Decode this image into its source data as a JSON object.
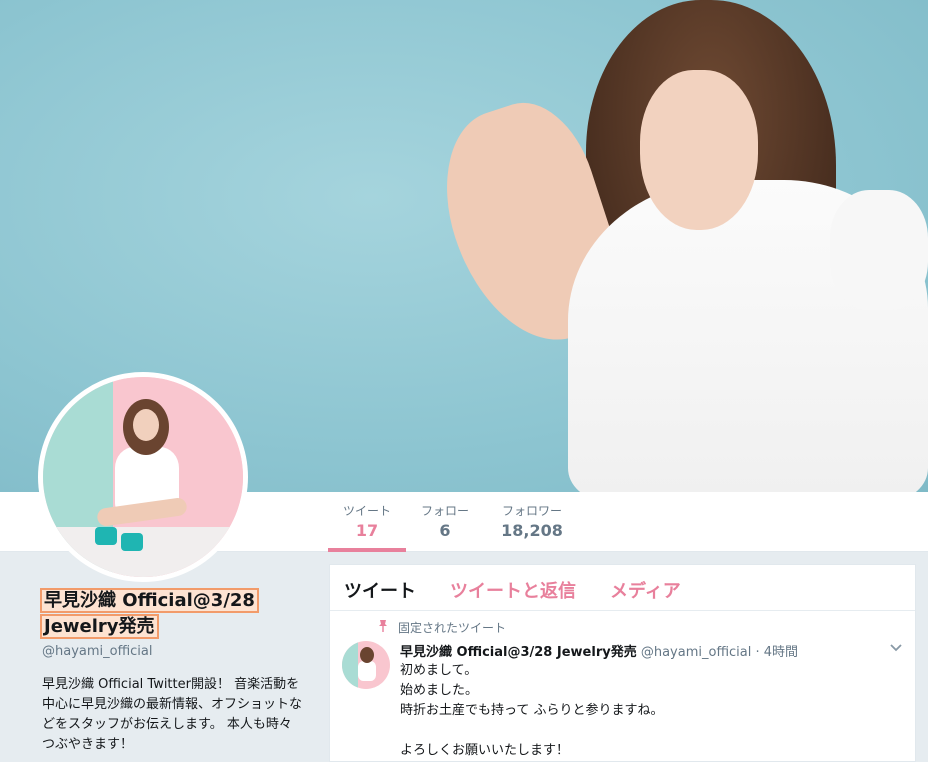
{
  "stats": [
    {
      "label": "ツイート",
      "value": "17"
    },
    {
      "label": "フォロー",
      "value": "6"
    },
    {
      "label": "フォロワー",
      "value": "18,208"
    }
  ],
  "profile": {
    "name_line1": "早見沙織 Official@3/28",
    "name_line2": "Jewelry発売",
    "handle": "@hayami_official",
    "bio": "早見沙織 Official Twitter開設！ 音楽活動を中心に早見沙織の最新情報、オフショットなどをスタッフがお伝えします。 本人も時々つぶやきます！"
  },
  "tabs": [
    {
      "label": "ツイート"
    },
    {
      "label": "ツイートと返信"
    },
    {
      "label": "メディア"
    }
  ],
  "tweet": {
    "pinned_label": "固定されたツイート",
    "name": "早見沙織 Official@3/28 Jewelry発売",
    "handle": "@hayami_official",
    "separator": "·",
    "time": "4時間",
    "body": "初めまして。\n始めました。\n時折お土産でも持って ふらりと参りますね。\n\nよろしくお願いいたします！"
  },
  "icons": {
    "pin": "pin-icon",
    "menu": "chevron-down-icon"
  },
  "colors": {
    "accent": "#e8809c",
    "banner": "#8cc6d2"
  }
}
